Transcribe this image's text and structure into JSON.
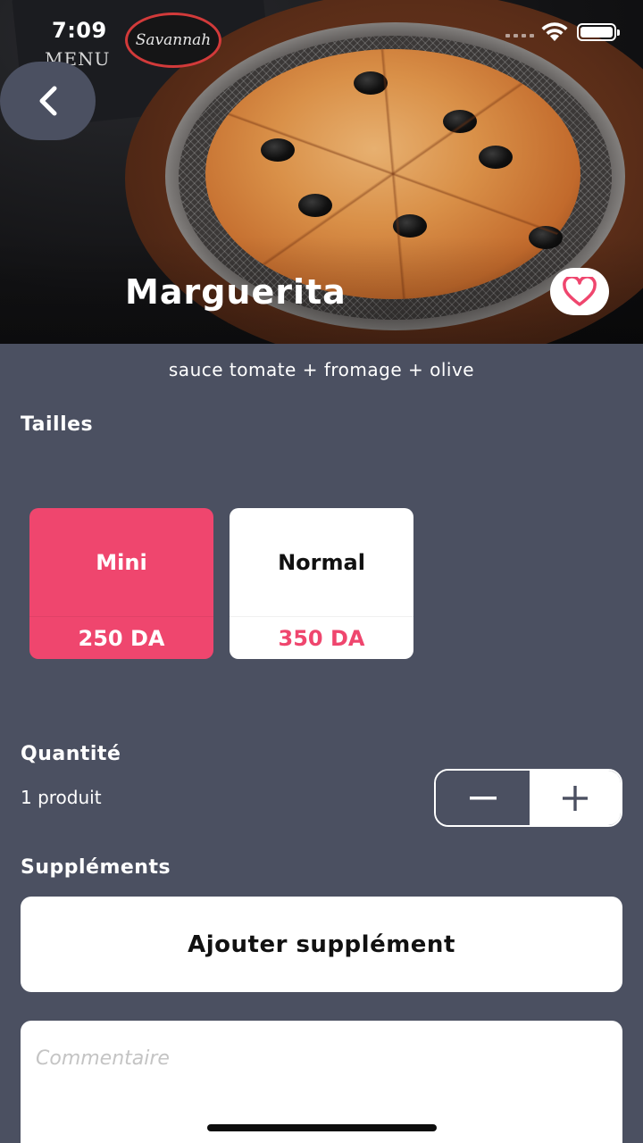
{
  "status_bar": {
    "time": "7:09"
  },
  "product": {
    "name": "Marguerita",
    "description": "sauce tomate + fromage + olive",
    "hero_logo_text": "Savannah",
    "hero_menu_text": "MENU"
  },
  "sizes": {
    "label": "Tailles",
    "options": [
      {
        "name": "Mini",
        "price": "250 DA",
        "selected": true
      },
      {
        "name": "Normal",
        "price": "350 DA",
        "selected": false
      }
    ]
  },
  "quantity": {
    "label": "Quantité",
    "summary": "1 produit",
    "value": 1
  },
  "supplements": {
    "label": "Suppléments",
    "add_button": "Ajouter supplément"
  },
  "comment": {
    "placeholder": "Commentaire"
  },
  "colors": {
    "background": "#4b5061",
    "accent": "#ef466e",
    "card": "#ffffff"
  },
  "icons": {
    "back": "chevron-left-icon",
    "favorite": "heart-icon",
    "minus": "minus-icon",
    "plus": "plus-icon",
    "wifi": "wifi-icon",
    "battery": "battery-icon"
  }
}
